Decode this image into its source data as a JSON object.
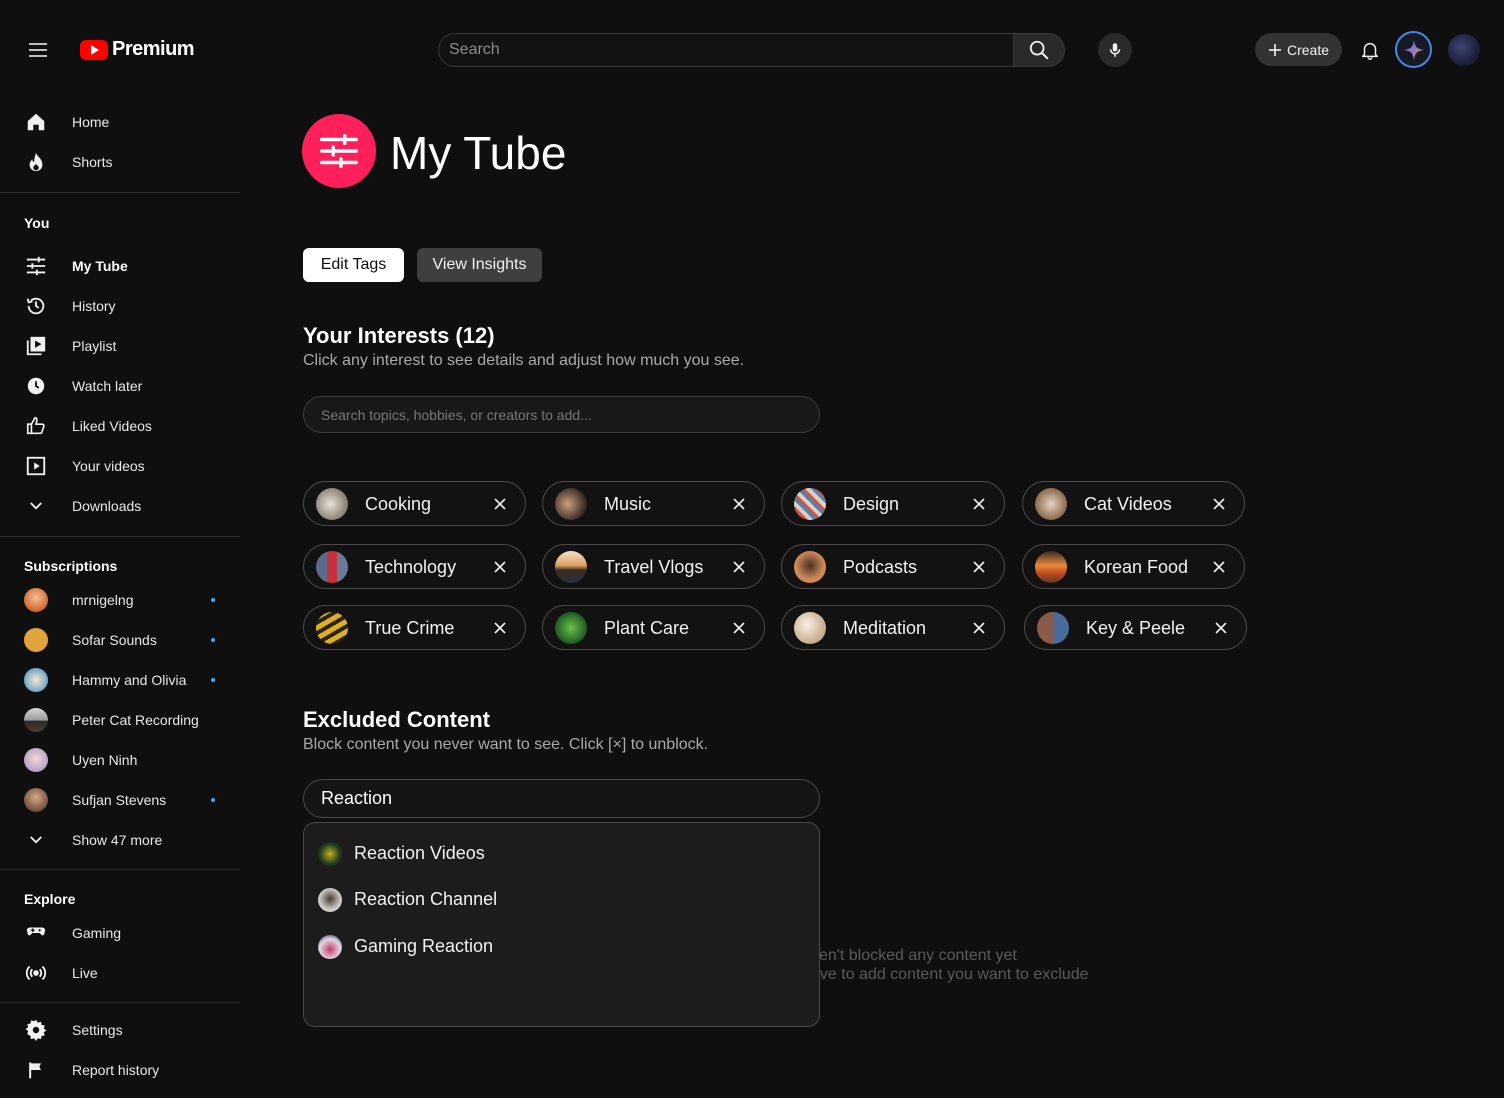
{
  "header": {
    "logo_text": "Premium",
    "search_placeholder": "Search",
    "create_label": "Create"
  },
  "sidebar": {
    "top": [
      {
        "label": "Home",
        "icon": "home-icon"
      },
      {
        "label": "Shorts",
        "icon": "shorts-icon"
      }
    ],
    "you_heading": "You",
    "you": [
      {
        "label": "My Tube",
        "icon": "sliders-icon"
      },
      {
        "label": "History",
        "icon": "history-icon"
      },
      {
        "label": "Playlist",
        "icon": "playlist-icon"
      },
      {
        "label": "Watch later",
        "icon": "clock-icon"
      },
      {
        "label": "Liked Videos",
        "icon": "thumbs-up-icon"
      },
      {
        "label": "Your videos",
        "icon": "video-icon"
      },
      {
        "label": "Downloads",
        "icon": "chevron-down-icon"
      }
    ],
    "subscriptions_heading": "Subscriptions",
    "subscriptions": [
      {
        "label": "mrnigelng",
        "new": true
      },
      {
        "label": "Sofar Sounds",
        "new": true
      },
      {
        "label": "Hammy and Olivia",
        "new": true
      },
      {
        "label": "Peter Cat Recording",
        "new": false
      },
      {
        "label": "Uyen Ninh",
        "new": false
      },
      {
        "label": "Sufjan Stevens",
        "new": true
      }
    ],
    "show_more": "Show 47 more",
    "explore_heading": "Explore",
    "explore": [
      {
        "label": "Gaming",
        "icon": "gamepad-icon"
      },
      {
        "label": "Live",
        "icon": "live-icon"
      }
    ],
    "bottom": [
      {
        "label": "Settings",
        "icon": "gear-icon"
      },
      {
        "label": "Report history",
        "icon": "flag-icon"
      }
    ]
  },
  "page": {
    "title": "My Tube",
    "edit_tags": "Edit Tags",
    "view_insights": "View Insights"
  },
  "interests": {
    "title": "Your Interests (12)",
    "subtitle": "Click any interest to see details and adjust how much you see.",
    "search_placeholder": "Search topics, hobbies, or creators to add...",
    "chips": [
      "Cooking",
      "Music",
      "Design",
      "Cat Videos",
      "Technology",
      "Travel Vlogs",
      "Podcasts",
      "Korean Food",
      "True Crime",
      "Plant Care",
      "Meditation",
      "Key & Peele"
    ]
  },
  "excluded": {
    "title": "Excluded Content",
    "subtitle": "Block content you never want to see. Click [×] to unblock.",
    "input_value": "Reaction",
    "empty_line1": "ven't blocked any content yet",
    "empty_line2": "ove to add content you want to exclude",
    "suggestions": [
      "Reaction Videos",
      "Reaction Channel",
      "Gaming Reaction"
    ]
  },
  "colors": {
    "accent": "#ff1f5a",
    "brand_red": "#ff0000",
    "new_dot": "#3ea6ff",
    "background": "#0f0f0f"
  }
}
